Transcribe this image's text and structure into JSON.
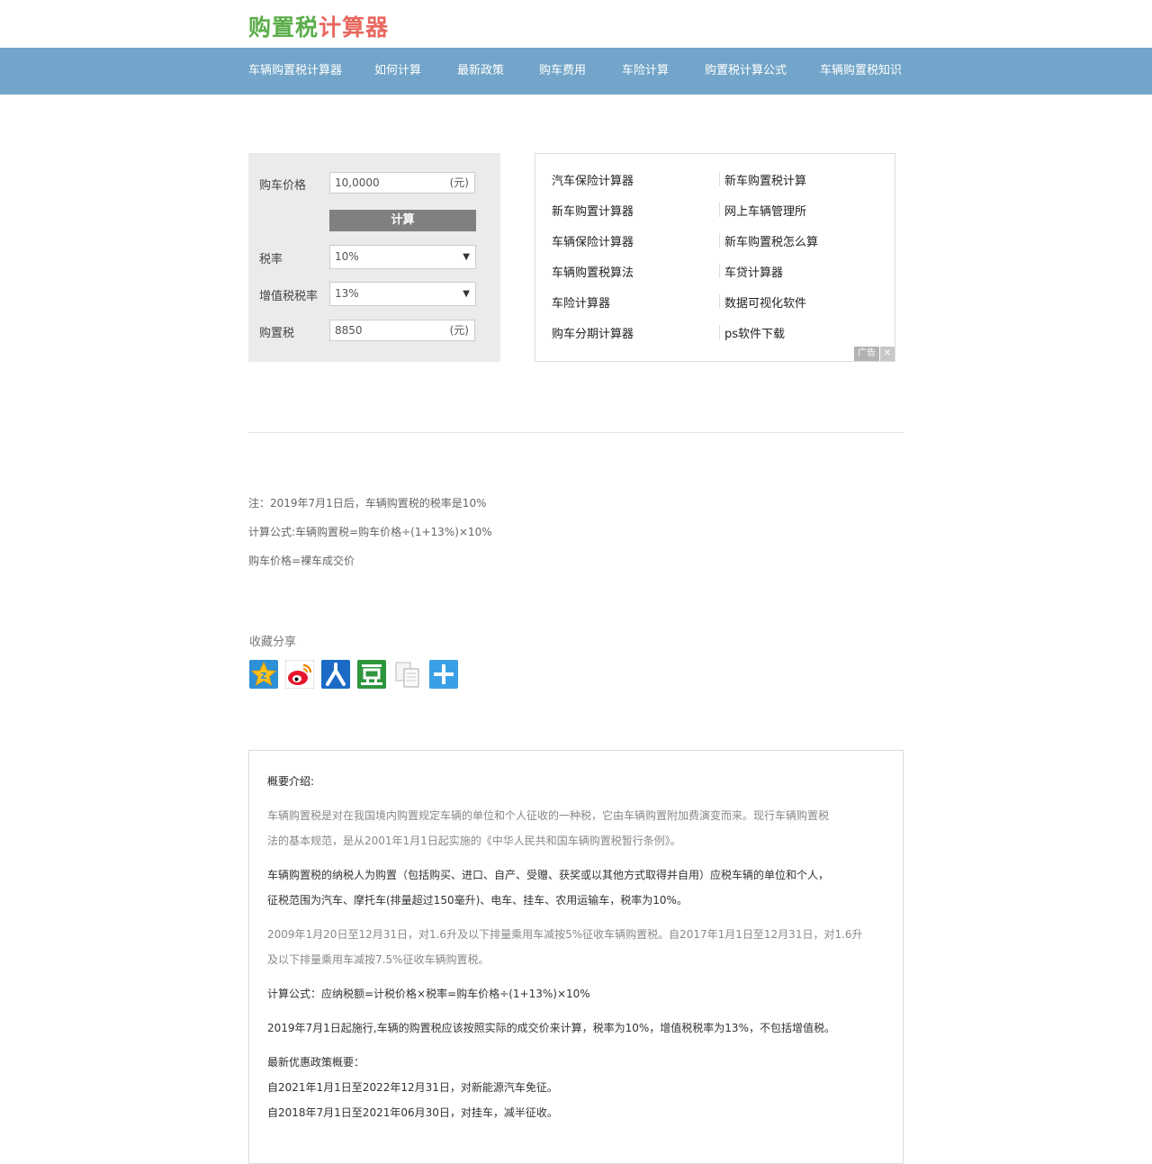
{
  "header": {
    "logo_chars": [
      "购",
      "置",
      "税",
      "计",
      "算",
      "器"
    ],
    "logo_colors": [
      "#5cae4b",
      "#5cae4b",
      "#5cae4b",
      "#e8685f",
      "#e8685f",
      "#e8685f"
    ]
  },
  "nav": {
    "items": [
      "车辆购置税计算器",
      "如何计算",
      "最新政策",
      "购车费用",
      "车险计算",
      "购置税计算公式",
      "车辆购置税知识"
    ]
  },
  "calculator": {
    "price_label": "购车价格",
    "price_value": "10,0000",
    "price_unit": "(元)",
    "calc_button": "计算",
    "tax_rate_label": "税率",
    "tax_rate_value": "10%",
    "vat_label": "增值税税率",
    "vat_value": "13%",
    "purchase_tax_label": "购置税",
    "purchase_tax_value": "8850",
    "purchase_tax_unit": "(元)"
  },
  "ad": {
    "links_left": [
      "汽车保险计算器",
      "新车购置计算器",
      "车辆保险计算器",
      "车辆购置税算法",
      "车险计算器",
      "购车分期计算器"
    ],
    "links_right": [
      "新车购置税计算",
      "网上车辆管理所",
      "新车购置税怎么算",
      "车贷计算器",
      "数据可视化软件",
      "ps软件下载"
    ],
    "badge": "广告",
    "close": "✕"
  },
  "notes": {
    "line1": "注：2019年7月1日后，车辆购置税的税率是10%",
    "line2": "计算公式:车辆购置税=购车价格÷(1+13%)×10%",
    "line3": "购车价格=裸车成交价"
  },
  "share": {
    "title": "收藏分享",
    "icons": [
      "qzone-icon",
      "weibo-icon",
      "renren-icon",
      "douban-icon",
      "copy-icon",
      "more-icon"
    ]
  },
  "intro": {
    "heading": "概要介绍:",
    "p1a": "车辆购置税是对在我国境内购置规定车辆的单位和个人征收的一种税，它由车辆购置附加费演变而来。现行车辆购置税",
    "p1b": "法的基本规范，是从2001年1月1日起实施的《中华人民共和国车辆购置税暂行条例》。",
    "p2a": "车辆购置税的纳税人为购置（包括购买、进口、自产、受赠、获奖或以其他方式取得并自用）应税车辆的单位和个人，",
    "p2b": "征税范围为汽车、摩托车(排量超过150毫升)、电车、挂车、农用运输车，税率为10%。",
    "p3a": "2009年1月20日至12月31日，对1.6升及以下排量乘用车减按5%征收车辆购置税。自2017年1月1日至12月31日，对1.6升",
    "p3b": "及以下排量乘用车减按7.5%征收车辆购置税。",
    "p4": "计算公式：应纳税额=计税价格×税率=购车价格÷(1+13%)×10%",
    "p5": "2019年7月1日起施行,车辆的购置税应该按照实际的成交价来计算，税率为10%，增值税税率为13%，不包括增值税。",
    "p6": "最新优惠政策概要：",
    "p7": "自2021年1月1日至2022年12月31日，对新能源汽车免征。",
    "p8": "自2018年7月1日至2021年06月30日，对挂车，减半征收。"
  }
}
